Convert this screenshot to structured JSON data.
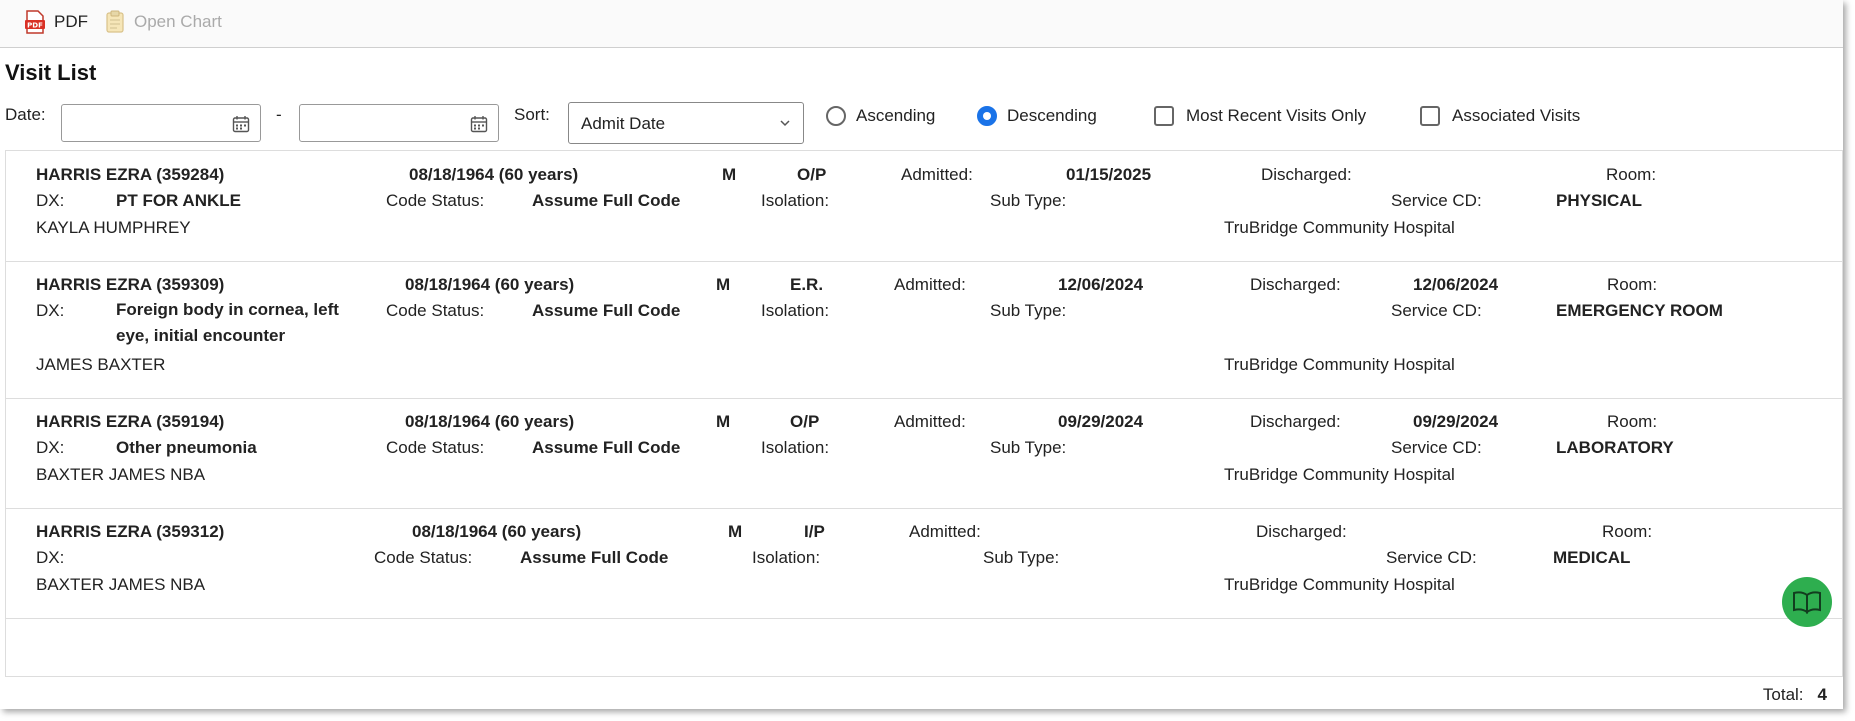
{
  "toolbar": {
    "pdf_label": "PDF",
    "open_chart_label": "Open Chart"
  },
  "page_title": "Visit List",
  "filters": {
    "date_label": "Date:",
    "date_separator": "-",
    "date_from": "",
    "date_to": "",
    "sort_label": "Sort:",
    "sort_value": "Admit Date",
    "ascending_label": "Ascending",
    "descending_label": "Descending",
    "sort_direction": "Descending",
    "most_recent_label": "Most Recent Visits Only",
    "most_recent_checked": false,
    "associated_label": "Associated Visits",
    "associated_checked": false
  },
  "labels": {
    "dx": "DX:",
    "code_status": "Code Status:",
    "isolation": "Isolation:",
    "sub_type": "Sub Type:",
    "admitted": "Admitted:",
    "discharged": "Discharged:",
    "room": "Room:",
    "service_cd": "Service CD:"
  },
  "visits": [
    {
      "patient": "HARRIS EZRA (359284)",
      "dob": "08/18/1964 (60 years)",
      "sex": "M",
      "type": "O/P",
      "admitted": "01/15/2025",
      "discharged": "",
      "room": "",
      "dx": "PT FOR ANKLE",
      "code_status": "Assume Full Code",
      "isolation": "",
      "sub_type": "",
      "service_cd": "PHYSICAL",
      "provider": "KAYLA HUMPHREY",
      "facility": "TruBridge Community Hospital"
    },
    {
      "patient": "HARRIS EZRA (359309)",
      "dob": "08/18/1964 (60 years)",
      "sex": "M",
      "type": "E.R.",
      "admitted": "12/06/2024",
      "discharged": "12/06/2024",
      "room": "",
      "dx": "Foreign body in cornea, left eye, initial encounter",
      "code_status": "Assume Full Code",
      "isolation": "",
      "sub_type": "",
      "service_cd": "EMERGENCY ROOM",
      "provider": "JAMES BAXTER",
      "facility": "TruBridge Community Hospital"
    },
    {
      "patient": "HARRIS EZRA (359194)",
      "dob": "08/18/1964 (60 years)",
      "sex": "M",
      "type": "O/P",
      "admitted": "09/29/2024",
      "discharged": "09/29/2024",
      "room": "",
      "dx": "Other pneumonia",
      "code_status": "Assume Full Code",
      "isolation": "",
      "sub_type": "",
      "service_cd": "LABORATORY",
      "provider": "BAXTER JAMES NBA",
      "facility": "TruBridge Community Hospital"
    },
    {
      "patient": "HARRIS EZRA (359312)",
      "dob": "08/18/1964 (60 years)",
      "sex": "M",
      "type": "I/P",
      "admitted": "",
      "discharged": "",
      "room": "",
      "dx": "",
      "code_status": "Assume Full Code",
      "isolation": "",
      "sub_type": "",
      "service_cd": "MEDICAL",
      "provider": "BAXTER JAMES NBA",
      "facility": "TruBridge Community Hospital"
    }
  ],
  "footer": {
    "total_label": "Total:",
    "total_value": "4"
  },
  "icons": {
    "pdf": "pdf-icon",
    "open_chart": "clipboard-icon",
    "calendar": "calendar-icon",
    "chevron": "chevron-down-icon",
    "help": "book-icon"
  },
  "colors": {
    "accent": "#1a73e8",
    "help_button": "#2eae4f",
    "pdf_red": "#d93025"
  }
}
